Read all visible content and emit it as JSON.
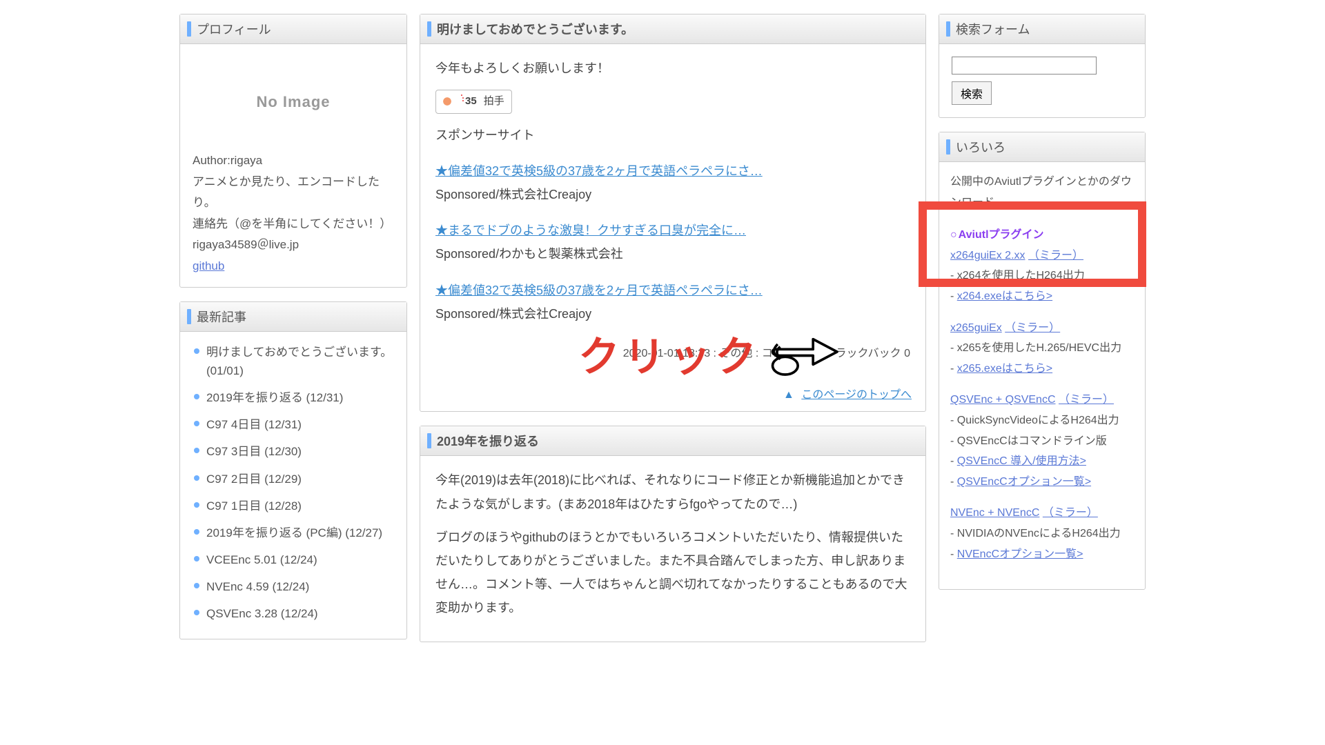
{
  "leftSidebar": {
    "profile": {
      "header": "プロフィール",
      "noimage": "No Image",
      "author": "Author:rigaya",
      "line1": "アニメとか見たり、エンコードしたり。",
      "line2": "連絡先（@を半角にしてください！）",
      "email": "rigaya34589＠live.jp",
      "github": "github"
    },
    "recent": {
      "header": "最新記事",
      "items": [
        "明けましておめでとうございます。 (01/01)",
        "2019年を振り返る (12/31)",
        "C97 4日目 (12/31)",
        "C97 3日目 (12/30)",
        "C97 2日目 (12/29)",
        "C97 1日目 (12/28)",
        "2019年を振り返る (PC編) (12/27)",
        "VCEEnc 5.01 (12/24)",
        "NVEnc 4.59 (12/24)",
        "QSVEnc 3.28 (12/24)"
      ]
    }
  },
  "main": {
    "article1": {
      "title": "明けましておめでとうございます。",
      "greeting": "今年もよろしくお願いします！",
      "clap_count": "35",
      "clap_label": "拍手",
      "sponsor_label": "スポンサーサイト",
      "ads": [
        {
          "title": "★偏差値32で英検5級の37歳を2ヶ月で英語ペラペラにさ…",
          "line": "Sponsored/株式会社Creajoy"
        },
        {
          "title": "★まるでドブのような激臭！クサすぎる口臭が完全に…",
          "line": "Sponsored/わかもと製薬株式会社"
        },
        {
          "title": "★偏差値32で英検5級の37歳を2ヶ月で英語ペラペラにさ…",
          "line": "Sponsored/株式会社Creajoy"
        }
      ],
      "meta": "2020-01-01 18:33 : その他 : コメント 0 : トラックバック 0",
      "pagetop": "このページのトップへ"
    },
    "article2": {
      "title": "2019年を振り返る",
      "p1": "今年(2019)は去年(2018)に比べれば、それなりにコード修正とか新機能追加とかできたような気がします。(まあ2018年はひたすらfgoやってたので…)",
      "p2": "ブログのほうやgithubのほうとかでもいろいろコメントいただいたり、情報提供いただいたりしてありがとうございました。また不具合踏んでしまった方、申し訳ありません…。コメント等、一人ではちゃんと調べ切れてなかったりすることもあるので大変助かります。"
    }
  },
  "rightSidebar": {
    "search": {
      "header": "検索フォーム",
      "placeholder": "",
      "button": "検索"
    },
    "downloads": {
      "header": "いろいろ",
      "intro": "公開中のAviutlプラグインとかのダウンロード",
      "section_head": "Aviutlプラグイン",
      "blocks": [
        {
          "link": "x264guiEx 2.xx",
          "mirror": "（ミラー）",
          "note1": "- x264を使用したH264出力",
          "note2": "- x264.exeはこちら>"
        },
        {
          "link": "x265guiEx",
          "mirror": "（ミラー）",
          "note1": "- x265を使用したH.265/HEVC出力",
          "note2": "- x265.exeはこちら>"
        },
        {
          "link": "QSVEnc + QSVEncC",
          "mirror": "（ミラー）",
          "note1": "- QuickSyncVideoによるH264出力",
          "note2": "- QSVEncCはコマンドライン版",
          "note3": "- QSVEncC 導入/使用方法>",
          "note4": "- QSVEncCオプション一覧>"
        },
        {
          "link": "NVEnc + NVEncC",
          "mirror": "（ミラー）",
          "note1": "- NVIDIAのNVEncによるH264出力",
          "note2": "- NVEncCオプション一覧>"
        }
      ]
    }
  },
  "overlay": {
    "click_label": "クリック"
  }
}
